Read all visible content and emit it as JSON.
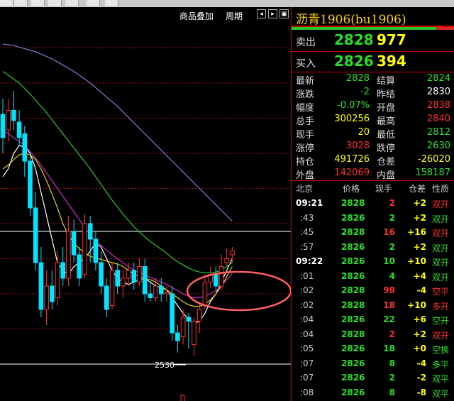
{
  "toolbar": {
    "overlay_label": "商品叠加",
    "period_label": "周期"
  },
  "chart_data": {
    "type": "candlestick",
    "low_marker": "2530",
    "candles": [
      {
        "o": 2840,
        "c": 2810,
        "h": 2860,
        "l": 2790
      },
      {
        "o": 2820,
        "c": 2845,
        "h": 2860,
        "l": 2805
      },
      {
        "o": 2845,
        "c": 2832,
        "h": 2870,
        "l": 2820
      },
      {
        "o": 2830,
        "c": 2810,
        "h": 2845,
        "l": 2800
      },
      {
        "o": 2815,
        "c": 2780,
        "h": 2825,
        "l": 2760
      },
      {
        "o": 2780,
        "c": 2720,
        "h": 2790,
        "l": 2710
      },
      {
        "o": 2720,
        "c": 2650,
        "h": 2740,
        "l": 2640
      },
      {
        "o": 2650,
        "c": 2590,
        "h": 2670,
        "l": 2580
      },
      {
        "o": 2590,
        "c": 2620,
        "h": 2640,
        "l": 2570
      },
      {
        "o": 2620,
        "c": 2600,
        "h": 2640,
        "l": 2590
      },
      {
        "o": 2605,
        "c": 2650,
        "h": 2665,
        "l": 2595
      },
      {
        "o": 2650,
        "c": 2630,
        "h": 2670,
        "l": 2620
      },
      {
        "o": 2630,
        "c": 2690,
        "h": 2710,
        "l": 2620
      },
      {
        "o": 2690,
        "c": 2660,
        "h": 2705,
        "l": 2650
      },
      {
        "o": 2660,
        "c": 2630,
        "h": 2670,
        "l": 2620
      },
      {
        "o": 2635,
        "c": 2700,
        "h": 2712,
        "l": 2630
      },
      {
        "o": 2700,
        "c": 2680,
        "h": 2710,
        "l": 2650
      },
      {
        "o": 2680,
        "c": 2650,
        "h": 2690,
        "l": 2640
      },
      {
        "o": 2650,
        "c": 2620,
        "h": 2665,
        "l": 2610
      },
      {
        "o": 2620,
        "c": 2590,
        "h": 2630,
        "l": 2580
      },
      {
        "o": 2595,
        "c": 2640,
        "h": 2650,
        "l": 2590
      },
      {
        "o": 2640,
        "c": 2620,
        "h": 2650,
        "l": 2610
      },
      {
        "o": 2620,
        "c": 2630,
        "h": 2640,
        "l": 2605
      },
      {
        "o": 2630,
        "c": 2640,
        "h": 2650,
        "l": 2620
      },
      {
        "o": 2640,
        "c": 2625,
        "h": 2650,
        "l": 2615
      },
      {
        "o": 2625,
        "c": 2645,
        "h": 2655,
        "l": 2620
      },
      {
        "o": 2645,
        "c": 2610,
        "h": 2655,
        "l": 2600
      },
      {
        "o": 2610,
        "c": 2605,
        "h": 2625,
        "l": 2600
      },
      {
        "o": 2605,
        "c": 2620,
        "h": 2630,
        "l": 2600
      },
      {
        "o": 2620,
        "c": 2610,
        "h": 2630,
        "l": 2600
      },
      {
        "o": 2610,
        "c": 2612,
        "h": 2620,
        "l": 2600
      },
      {
        "o": 2610,
        "c": 2560,
        "h": 2620,
        "l": 2550
      },
      {
        "o": 2560,
        "c": 2550,
        "h": 2570,
        "l": 2535
      },
      {
        "o": 2555,
        "c": 2580,
        "h": 2590,
        "l": 2545
      },
      {
        "o": 2580,
        "c": 2575,
        "h": 2585,
        "l": 2540
      },
      {
        "o": 2545,
        "c": 2575,
        "h": 2580,
        "l": 2530
      },
      {
        "o": 2575,
        "c": 2590,
        "h": 2600,
        "l": 2560
      },
      {
        "o": 2595,
        "c": 2625,
        "h": 2635,
        "l": 2590
      },
      {
        "o": 2625,
        "c": 2635,
        "h": 2645,
        "l": 2618
      },
      {
        "o": 2635,
        "c": 2620,
        "h": 2645,
        "l": 2615
      },
      {
        "o": 2620,
        "c": 2645,
        "h": 2660,
        "l": 2615
      },
      {
        "o": 2650,
        "c": 2655,
        "h": 2668,
        "l": 2645
      },
      {
        "o": 2660,
        "c": 2665,
        "h": 2670,
        "l": 2650
      }
    ],
    "ma": [
      {
        "color": "#ffffff",
        "values": [
          2760,
          2770,
          2790,
          2800,
          2798,
          2790,
          2770,
          2740,
          2710,
          2680,
          2650,
          2640,
          2635,
          2645,
          2650,
          2655,
          2665,
          2675,
          2670,
          2655,
          2640,
          2630,
          2625,
          2622,
          2625,
          2628,
          2630,
          2625,
          2620,
          2618,
          2615,
          2605,
          2595,
          2585,
          2578,
          2572,
          2575,
          2585,
          2600,
          2610,
          2625,
          2640,
          2655
        ]
      },
      {
        "color": "#e6d200",
        "values": [
          2770,
          2775,
          2782,
          2788,
          2790,
          2788,
          2782,
          2770,
          2755,
          2738,
          2720,
          2700,
          2685,
          2675,
          2668,
          2662,
          2658,
          2656,
          2654,
          2652,
          2650,
          2648,
          2645,
          2640,
          2635,
          2632,
          2630,
          2628,
          2625,
          2620,
          2615,
          2610,
          2605,
          2600,
          2596,
          2594,
          2594,
          2597,
          2602,
          2610,
          2620,
          2632,
          2645
        ]
      },
      {
        "color": "#c828c8",
        "values": [
          2820,
          2815,
          2810,
          2805,
          2800,
          2792,
          2784,
          2775,
          2765,
          2755,
          2745,
          2735,
          2725,
          2715,
          2705,
          2695,
          2685,
          2678,
          2672,
          2666,
          2660,
          2655,
          2650,
          2645,
          2640,
          2637,
          2634,
          2631,
          2628,
          2625,
          2622,
          2618,
          2614,
          2610,
          2607,
          2605,
          2605,
          2607,
          2610,
          2614,
          2620,
          2628,
          2636
        ]
      },
      {
        "color": "#28c828",
        "values": [
          2895,
          2890,
          2885,
          2880,
          2873,
          2866,
          2858,
          2850,
          2842,
          2833,
          2824,
          2815,
          2806,
          2797,
          2788,
          2779,
          2770,
          2760,
          2750,
          2740,
          2730,
          2721,
          2712,
          2704,
          2696,
          2689,
          2683,
          2677,
          2672,
          2667,
          2662,
          2656,
          2651,
          2647,
          2643,
          2640,
          2638,
          2637,
          2637,
          2638,
          2640,
          2645,
          2650
        ]
      },
      {
        "color": "#8080d8",
        "values": [
          2930,
          2929,
          2928,
          2926,
          2924,
          2922,
          2920,
          2917,
          2914,
          2911,
          2907,
          2903,
          2899,
          2895,
          2890,
          2885,
          2880,
          2874,
          2868,
          2862,
          2856,
          2850,
          2843,
          2836,
          2829,
          2822,
          2815,
          2808,
          2801,
          2794,
          2787,
          2780,
          2773,
          2766,
          2759,
          2752,
          2745,
          2738,
          2731,
          2724,
          2717,
          2710,
          2703
        ]
      }
    ]
  },
  "panel": {
    "title": "沥青1906(bu1906)",
    "sell_label": "卖出",
    "sell_price": "2828",
    "sell_vol": "977",
    "buy_label": "买入",
    "buy_price": "2826",
    "buy_vol": "394",
    "stats_left": [
      {
        "label": "最新",
        "value": "2828",
        "color": "#28e028"
      },
      {
        "label": "涨跌",
        "value": "-2",
        "color": "#28e028"
      },
      {
        "label": "幅度",
        "value": "-0.07%",
        "color": "#28e028"
      },
      {
        "label": "总手",
        "value": "300256",
        "color": "#ffff00"
      },
      {
        "label": "现手",
        "value": "20",
        "color": "#ffff00"
      },
      {
        "label": "涨停",
        "value": "3028",
        "color": "#ff3030"
      },
      {
        "label": "持仓",
        "value": "491726",
        "color": "#ffff00"
      },
      {
        "label": "外盘",
        "value": "142069",
        "color": "#ff3030"
      }
    ],
    "stats_right": [
      {
        "label": "结算",
        "value": "2824",
        "color": "#28e028"
      },
      {
        "label": "昨结",
        "value": "2830",
        "color": "#ffffff"
      },
      {
        "label": "开盘",
        "value": "2838",
        "color": "#ff3030"
      },
      {
        "label": "最高",
        "value": "2840",
        "color": "#ff3030"
      },
      {
        "label": "最低",
        "value": "2812",
        "color": "#28e028"
      },
      {
        "label": "跌停",
        "value": "2630",
        "color": "#28e028"
      },
      {
        "label": "仓差",
        "value": "-26020",
        "color": "#ffff00"
      },
      {
        "label": "内盘",
        "value": "158187",
        "color": "#28e028"
      }
    ],
    "tick_headers": [
      "北京",
      "价格",
      "现手",
      "仓差",
      "性质"
    ],
    "ticks": [
      {
        "time": "09:21",
        "price": "2828",
        "vol": "2",
        "oi": "+2",
        "type": "双开",
        "pc": "#28e028",
        "vc": "#ff3030",
        "tc": "#ff3030"
      },
      {
        "time": ":43",
        "price": "2826",
        "vol": "2",
        "oi": "+2",
        "type": "双开",
        "pc": "#28e028",
        "vc": "#28e028",
        "tc": "#28e028"
      },
      {
        "time": ":45",
        "price": "2828",
        "vol": "16",
        "oi": "+16",
        "type": "双开",
        "pc": "#28e028",
        "vc": "#ff3030",
        "tc": "#ff3030"
      },
      {
        "time": ":57",
        "price": "2826",
        "vol": "2",
        "oi": "+2",
        "type": "双开",
        "pc": "#28e028",
        "vc": "#28e028",
        "tc": "#28e028"
      },
      {
        "time": "09:22",
        "price": "2826",
        "vol": "10",
        "oi": "+10",
        "type": "双开",
        "pc": "#28e028",
        "vc": "#28e028",
        "tc": "#28e028"
      },
      {
        "time": ":01",
        "price": "2826",
        "vol": "4",
        "oi": "+4",
        "type": "双开",
        "pc": "#28e028",
        "vc": "#28e028",
        "tc": "#28e028"
      },
      {
        "time": ":02",
        "price": "2828",
        "vol": "98",
        "oi": "-4",
        "type": "空平",
        "pc": "#28e028",
        "vc": "#ff3030",
        "tc": "#ff3030"
      },
      {
        "time": ":02",
        "price": "2828",
        "vol": "18",
        "oi": "+10",
        "type": "多开",
        "pc": "#28e028",
        "vc": "#ff3030",
        "tc": "#ff3030"
      },
      {
        "time": ":04",
        "price": "2826",
        "vol": "22",
        "oi": "+6",
        "type": "空开",
        "pc": "#28e028",
        "vc": "#28e028",
        "tc": "#28e028"
      },
      {
        "time": ":04",
        "price": "2828",
        "vol": "2",
        "oi": "+2",
        "type": "双开",
        "pc": "#28e028",
        "vc": "#ff3030",
        "tc": "#ff3030"
      },
      {
        "time": ":05",
        "price": "2826",
        "vol": "18",
        "oi": "+0",
        "type": "空换",
        "pc": "#28e028",
        "vc": "#28e028",
        "tc": "#28e028"
      },
      {
        "time": ":07",
        "price": "2826",
        "vol": "8",
        "oi": "-4",
        "type": "多平",
        "pc": "#28e028",
        "vc": "#28e028",
        "tc": "#28e028"
      },
      {
        "time": ":07",
        "price": "2826",
        "vol": "2",
        "oi": "-2",
        "type": "双平",
        "pc": "#28e028",
        "vc": "#28e028",
        "tc": "#28e028"
      },
      {
        "time": ":08",
        "price": "2826",
        "vol": "8",
        "oi": "-8",
        "type": "双平",
        "pc": "#28e028",
        "vc": "#28e028",
        "tc": "#28e028"
      }
    ]
  }
}
